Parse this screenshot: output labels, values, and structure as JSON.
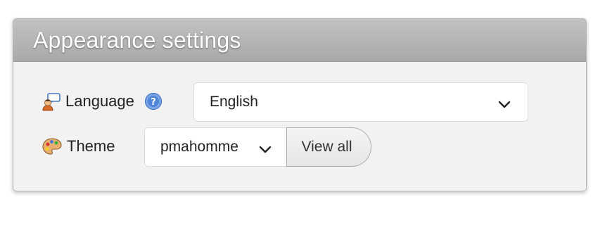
{
  "panel": {
    "title": "Appearance settings"
  },
  "language": {
    "label": "Language",
    "icon": "language-speech-icon",
    "help_icon": "help-question-icon",
    "selected": "English"
  },
  "theme": {
    "label": "Theme",
    "icon": "palette-icon",
    "selected": "pmahomme",
    "view_all_label": "View all"
  },
  "colors": {
    "header_bg": "#b0b0b0",
    "panel_bg": "#f2f2f2",
    "help_icon": "#5a8fd6"
  }
}
